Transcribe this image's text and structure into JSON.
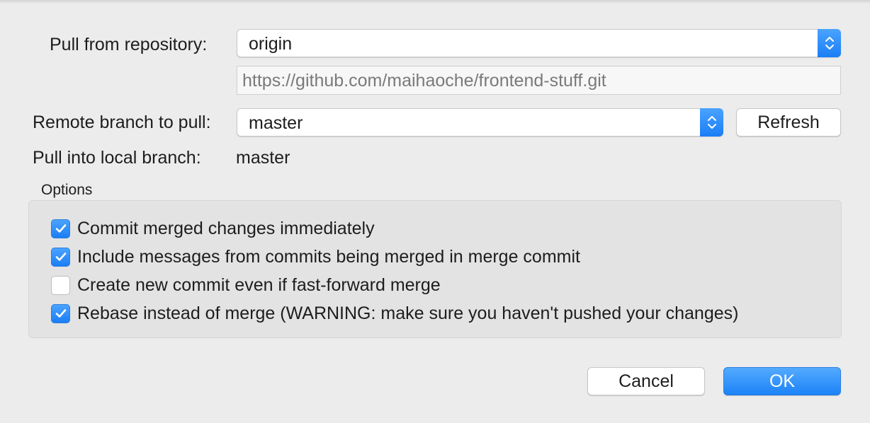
{
  "form": {
    "repository_label": "Pull from repository:",
    "repository_value": "origin",
    "repository_url": "https://github.com/maihaoche/frontend-stuff.git",
    "remote_branch_label": "Remote branch to pull:",
    "remote_branch_value": "master",
    "refresh_label": "Refresh",
    "local_branch_label": "Pull into local branch:",
    "local_branch_value": "master"
  },
  "options": {
    "title": "Options",
    "items": [
      {
        "label": "Commit merged changes immediately",
        "checked": true
      },
      {
        "label": "Include messages from commits being merged in merge commit",
        "checked": true
      },
      {
        "label": "Create new commit even if fast-forward merge",
        "checked": false
      },
      {
        "label": "Rebase instead of merge (WARNING: make sure you haven't pushed your changes)",
        "checked": true
      }
    ]
  },
  "buttons": {
    "cancel_label": "Cancel",
    "ok_label": "OK"
  },
  "colors": {
    "accent": "#1a7ef5",
    "background": "#ececec"
  }
}
